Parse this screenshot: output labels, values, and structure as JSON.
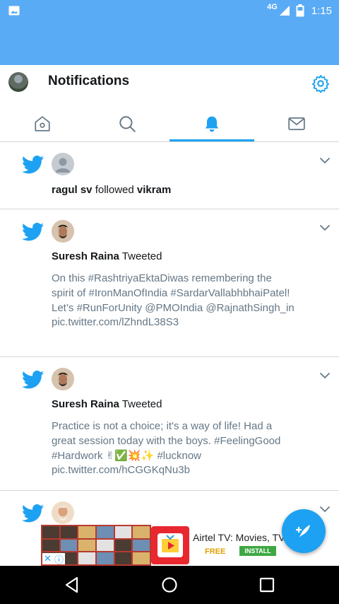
{
  "status_bar": {
    "network": "4G",
    "time": "1:15",
    "icons": [
      "gallery-icon",
      "signal-icon",
      "battery-icon"
    ]
  },
  "header": {
    "title": "Notifications",
    "icons": [
      "avatar",
      "gear-icon"
    ]
  },
  "tabs": [
    {
      "name": "home",
      "icon": "home-icon"
    },
    {
      "name": "search",
      "icon": "search-icon"
    },
    {
      "name": "notifications",
      "icon": "bell-icon",
      "active": true
    },
    {
      "name": "messages",
      "icon": "mail-icon"
    }
  ],
  "notifications": [
    {
      "actor": "ragul sv",
      "action": "followed",
      "target": "vikram"
    },
    {
      "actor": "Suresh Raina",
      "action": "Tweeted",
      "text": "On this #RashtriyaEktaDiwas remembering the spirit of #IronManOfIndia #SardarVallabhbhaiPatel! Let’s #RunForUnity @PMOIndia @RajnathSingh_in pic.twitter.com/lZhndL38S3"
    },
    {
      "actor": "Suresh Raina",
      "action": "Tweeted",
      "text": "Practice is not a choice; it's a way of life! Had a great session today with the boys. #FeelingGood #Hardwork ✌✅💥✨ #lucknow pic.twitter.com/hCGGKqNu3b"
    }
  ],
  "ad": {
    "title": "Airtel TV: Movies, TV ...",
    "price": "FREE",
    "install_label": "INSTALL"
  },
  "colors": {
    "status_bar": "#5aabf5",
    "accent": "#1da1f2",
    "text": "#14171a",
    "secondary_text": "#657786"
  }
}
